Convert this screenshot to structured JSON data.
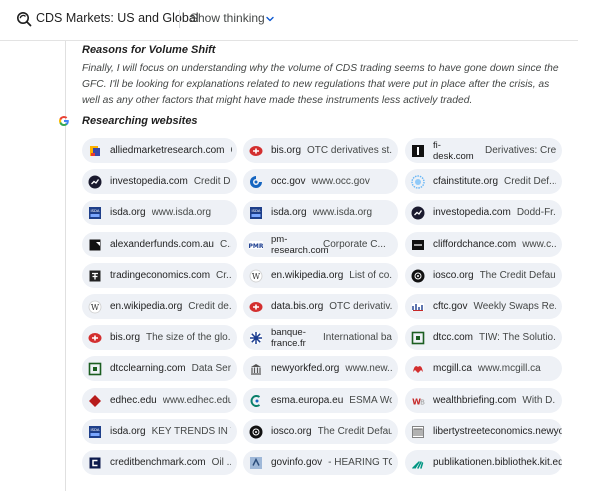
{
  "header": {
    "title": "CDS Markets: US and Global",
    "show_thinking": "Show thinking"
  },
  "section": {
    "heading": "Reasons for Volume Shift",
    "body": "Finally, I will focus on understanding why the volume of CDS trading seems to have gone down since the GFC. I'll be looking for explanations related to new regulations that were put in place after the crisis, as well as any other factors that might have made these instruments less actively traded."
  },
  "research": {
    "label": "Researching websites",
    "chips": [
      {
        "domain": "alliedmarketresearch.com",
        "title": "C...",
        "icon": "amr-icon"
      },
      {
        "domain": "bis.org",
        "title": "OTC derivatives st...",
        "icon": "bis-icon"
      },
      {
        "domain": "fi-desk.com",
        "title": "Derivatives: Cre...",
        "icon": "fidesk-icon"
      },
      {
        "domain": "investopedia.com",
        "title": "Credit D...",
        "icon": "investopedia-icon"
      },
      {
        "domain": "occ.gov",
        "title": "www.occ.gov",
        "icon": "occ-icon"
      },
      {
        "domain": "cfainstitute.org",
        "title": "Credit Def...",
        "icon": "cfa-icon"
      },
      {
        "domain": "isda.org",
        "title": "www.isda.org",
        "icon": "isda-icon"
      },
      {
        "domain": "isda.org",
        "title": "www.isda.org",
        "icon": "isda-icon"
      },
      {
        "domain": "investopedia.com",
        "title": "Dodd-Fr...",
        "icon": "investopedia-icon"
      },
      {
        "domain": "alexanderfunds.com.au",
        "title": "C...",
        "icon": "alexanderfunds-icon"
      },
      {
        "domain": "pm-research.com",
        "title": "Corporate C...",
        "icon": "pmr-icon"
      },
      {
        "domain": "cliffordchance.com",
        "title": "www.c...",
        "icon": "cliffordchance-icon"
      },
      {
        "domain": "tradingeconomics.com",
        "title": "Cr...",
        "icon": "tradingeconomics-icon"
      },
      {
        "domain": "en.wikipedia.org",
        "title": "List of co...",
        "icon": "wikipedia-icon"
      },
      {
        "domain": "iosco.org",
        "title": "The Credit Defau...",
        "icon": "iosco-icon"
      },
      {
        "domain": "en.wikipedia.org",
        "title": "Credit de...",
        "icon": "wikipedia-icon"
      },
      {
        "domain": "data.bis.org",
        "title": "OTC derivativ...",
        "icon": "bis-icon"
      },
      {
        "domain": "cftc.gov",
        "title": "Weekly Swaps Re...",
        "icon": "cftc-icon"
      },
      {
        "domain": "bis.org",
        "title": "The size of the glo...",
        "icon": "bis-icon"
      },
      {
        "domain": "banque-france.fr",
        "title": "International ban...",
        "icon": "banquefrance-icon"
      },
      {
        "domain": "dtcc.com",
        "title": "TIW: The Solutio...",
        "icon": "dtcc-icon"
      },
      {
        "domain": "dtcclearning.com",
        "title": "Data Ser...",
        "icon": "dtcc-icon"
      },
      {
        "domain": "newyorkfed.org",
        "title": "www.new...",
        "icon": "newyorkfed-icon"
      },
      {
        "domain": "mcgill.ca",
        "title": "www.mcgill.ca",
        "icon": "mcgill-icon"
      },
      {
        "domain": "edhec.edu",
        "title": "www.edhec.edu",
        "icon": "edhec-icon"
      },
      {
        "domain": "esma.europa.eu",
        "title": "ESMA Wor...",
        "icon": "esma-icon"
      },
      {
        "domain": "wealthbriefing.com",
        "title": "With D...",
        "icon": "wealthbriefing-icon"
      },
      {
        "domain": "isda.org",
        "title": "KEY TRENDS IN T...",
        "icon": "isda-icon"
      },
      {
        "domain": "iosco.org",
        "title": "The Credit Defau...",
        "icon": "iosco-icon"
      },
      {
        "domain": "libertystreeteconomics.newyork",
        "title": "",
        "icon": "libertystreet-icon"
      },
      {
        "domain": "creditbenchmark.com",
        "title": "Oil ...",
        "icon": "creditbenchmark-icon"
      },
      {
        "domain": "govinfo.gov",
        "title": "- HEARING TO...",
        "icon": "govinfo-icon"
      },
      {
        "domain": "publikationen.bibliothek.kit.edu",
        "title": "",
        "icon": "kit-icon"
      }
    ]
  }
}
